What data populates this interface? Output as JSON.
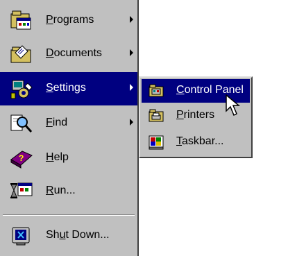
{
  "start_menu": {
    "items": [
      {
        "label": "Programs",
        "underline_index": 0,
        "icon": "programs-icon",
        "has_submenu": true
      },
      {
        "label": "Documents",
        "underline_index": 0,
        "icon": "documents-icon",
        "has_submenu": true
      },
      {
        "label": "Settings",
        "underline_index": 0,
        "icon": "settings-icon",
        "has_submenu": true,
        "highlighted": true
      },
      {
        "label": "Find",
        "underline_index": 0,
        "icon": "find-icon",
        "has_submenu": true
      },
      {
        "label": "Help",
        "underline_index": 0,
        "icon": "help-icon",
        "has_submenu": false
      },
      {
        "label": "Run...",
        "underline_index": 0,
        "icon": "run-icon",
        "has_submenu": false
      },
      {
        "label": "Shut Down...",
        "underline_index": 2,
        "icon": "shutdown-icon",
        "has_submenu": false
      }
    ]
  },
  "settings_submenu": {
    "items": [
      {
        "label": "Control Panel",
        "underline_index": 0,
        "icon": "control-panel-icon",
        "highlighted": true
      },
      {
        "label": "Printers",
        "underline_index": 0,
        "icon": "printers-icon"
      },
      {
        "label": "Taskbar...",
        "underline_index": 0,
        "icon": "taskbar-icon"
      }
    ]
  },
  "colors": {
    "menu_background": "#c0c0c0",
    "highlight": "#000080",
    "highlight_text": "#ffffff"
  }
}
